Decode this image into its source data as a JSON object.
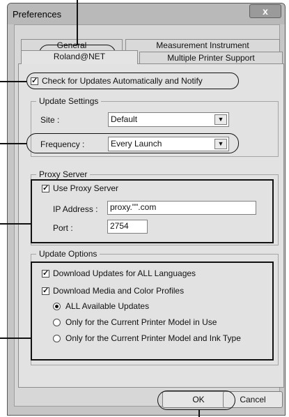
{
  "window": {
    "title": "Preferences",
    "close_glyph": "x"
  },
  "tabs": {
    "general": "General",
    "measurement": "Measurement Instrument",
    "roland": "Roland@NET",
    "multiple": "Multiple Printer Support"
  },
  "auto_check": {
    "label": "Check for Updates Automatically and Notify",
    "checked": true
  },
  "update_settings": {
    "legend": "Update Settings",
    "site_label": "Site :",
    "site_value": "Default",
    "frequency_label": "Frequency :",
    "frequency_value": "Every Launch"
  },
  "proxy": {
    "legend": "Proxy Server",
    "use_label": "Use Proxy Server",
    "use_checked": true,
    "ip_label": "IP Address :",
    "ip_value": "proxy.\"\".com",
    "port_label": "Port :",
    "port_value": "2754"
  },
  "update_options": {
    "legend": "Update Options",
    "all_languages": "Download Updates for ALL Languages",
    "media_profiles": "Download Media and Color Profiles",
    "radio_all": "ALL Available Updates",
    "radio_current_model": "Only for the Current Printer Model in Use",
    "radio_model_ink": "Only for the Current Printer Model and Ink Type",
    "selected": "ALL Available Updates"
  },
  "buttons": {
    "ok": "OK",
    "cancel": "Cancel"
  },
  "icons": {
    "check": "check-icon",
    "dropdown": "chevron-down-icon",
    "close": "close-icon"
  }
}
